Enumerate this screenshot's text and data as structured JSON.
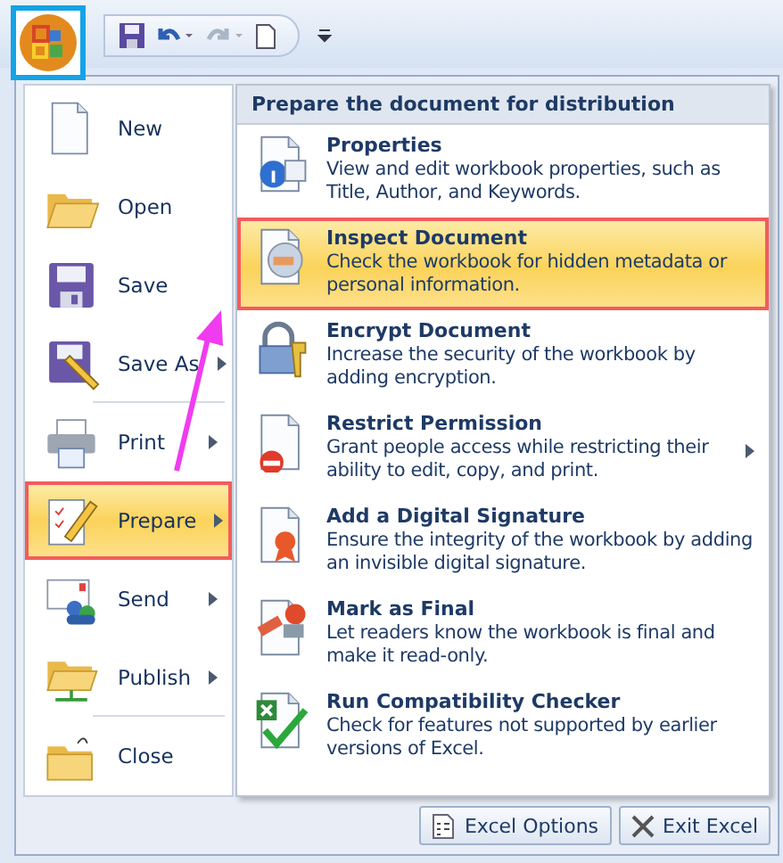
{
  "menu": {
    "items": [
      {
        "label": "New",
        "kind": "new",
        "submenu": false,
        "selected": false,
        "divider_after": false
      },
      {
        "label": "Open",
        "kind": "open",
        "submenu": false,
        "selected": false,
        "divider_after": false
      },
      {
        "label": "Save",
        "kind": "save",
        "submenu": false,
        "selected": false,
        "divider_after": false
      },
      {
        "label": "Save As",
        "kind": "saveas",
        "submenu": true,
        "selected": false,
        "divider_after": true
      },
      {
        "label": "Print",
        "kind": "print",
        "submenu": true,
        "selected": false,
        "divider_after": false
      },
      {
        "label": "Prepare",
        "kind": "prepare",
        "submenu": true,
        "selected": true,
        "divider_after": false
      },
      {
        "label": "Send",
        "kind": "send",
        "submenu": true,
        "selected": false,
        "divider_after": false
      },
      {
        "label": "Publish",
        "kind": "publish",
        "submenu": true,
        "selected": false,
        "divider_after": true
      },
      {
        "label": "Close",
        "kind": "close",
        "submenu": false,
        "selected": false,
        "divider_after": false
      }
    ]
  },
  "submenu": {
    "title": "Prepare the document for distribution",
    "items": [
      {
        "label": "Properties",
        "description": "View and edit workbook properties, such as Title, Author, and Keywords.",
        "kind": "properties",
        "submenu": false,
        "selected": false
      },
      {
        "label": "Inspect Document",
        "description": "Check the workbook for hidden metadata or personal information.",
        "kind": "inspect",
        "submenu": false,
        "selected": true
      },
      {
        "label": "Encrypt Document",
        "description": "Increase the security of the workbook by adding encryption.",
        "kind": "encrypt",
        "submenu": false,
        "selected": false
      },
      {
        "label": "Restrict Permission",
        "description": "Grant people access while restricting their ability to edit, copy, and print.",
        "kind": "restrict",
        "submenu": true,
        "selected": false
      },
      {
        "label": "Add a Digital Signature",
        "description": "Ensure the integrity of the workbook by adding an invisible digital signature.",
        "kind": "signature",
        "submenu": false,
        "selected": false
      },
      {
        "label": "Mark as Final",
        "description": "Let readers know the workbook is final and make it read-only.",
        "kind": "final",
        "submenu": false,
        "selected": false
      },
      {
        "label": "Run Compatibility Checker",
        "description": "Check for features not supported by earlier versions of Excel.",
        "kind": "compat",
        "submenu": false,
        "selected": false
      }
    ]
  },
  "footer_buttons": [
    {
      "label": "Excel Options",
      "kind": "options"
    },
    {
      "label": "Exit Excel",
      "kind": "exit"
    }
  ]
}
